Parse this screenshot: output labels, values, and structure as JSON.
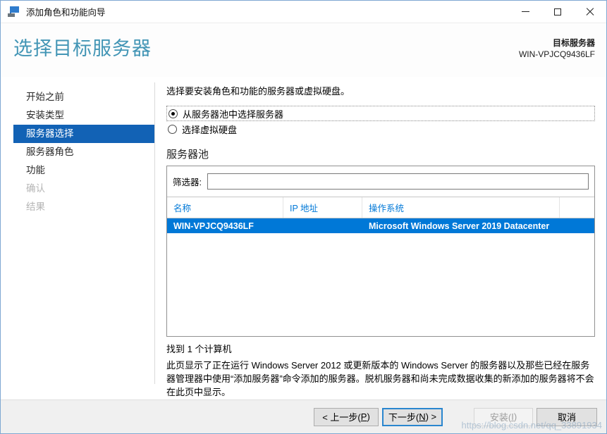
{
  "window": {
    "title": "添加角色和功能向导"
  },
  "header": {
    "page_title": "选择目标服务器",
    "target_label": "目标服务器",
    "target_server": "WIN-VPJCQ9436LF"
  },
  "sidebar": {
    "items": [
      {
        "label": "开始之前",
        "state": "normal"
      },
      {
        "label": "安装类型",
        "state": "normal"
      },
      {
        "label": "服务器选择",
        "state": "selected"
      },
      {
        "label": "服务器角色",
        "state": "normal"
      },
      {
        "label": "功能",
        "state": "normal"
      },
      {
        "label": "确认",
        "state": "disabled"
      },
      {
        "label": "结果",
        "state": "disabled"
      }
    ]
  },
  "content": {
    "intro": "选择要安装角色和功能的服务器或虚拟硬盘。",
    "radio_pool_label": "从服务器池中选择服务器",
    "radio_pool_selected": true,
    "radio_vhd_label": "选择虚拟硬盘",
    "radio_vhd_selected": false,
    "pool_title": "服务器池",
    "filter_label": "筛选器:",
    "filter_value": "",
    "table": {
      "columns": [
        "名称",
        "IP 地址",
        "操作系统"
      ],
      "rows": [
        {
          "name": "WIN-VPJCQ9436LF",
          "ip": "",
          "os": "Microsoft Windows Server 2019 Datacenter",
          "selected": true
        }
      ]
    },
    "found_text": "找到 1 个计算机",
    "description": "此页显示了正在运行 Windows Server 2012 或更新版本的 Windows Server 的服务器以及那些已经在服务器管理器中使用“添加服务器”命令添加的服务器。脱机服务器和尚未完成数据收集的新添加的服务器将不会在此页中显示。"
  },
  "footer": {
    "prev": {
      "pre": "< 上一步(",
      "key": "P",
      "post": ")"
    },
    "next": {
      "pre": "下一步(",
      "key": "N",
      "post": ") >"
    },
    "install": {
      "pre": "安装(",
      "key": "I",
      "post": ")"
    },
    "cancel": "取消"
  },
  "watermark": "https://blog.csdn.net/qq_33891934",
  "colors": {
    "accent_row": "#0078d7",
    "nav_selected": "#1262b5",
    "page_title": "#4295b5",
    "header_link": "#0078d7"
  }
}
